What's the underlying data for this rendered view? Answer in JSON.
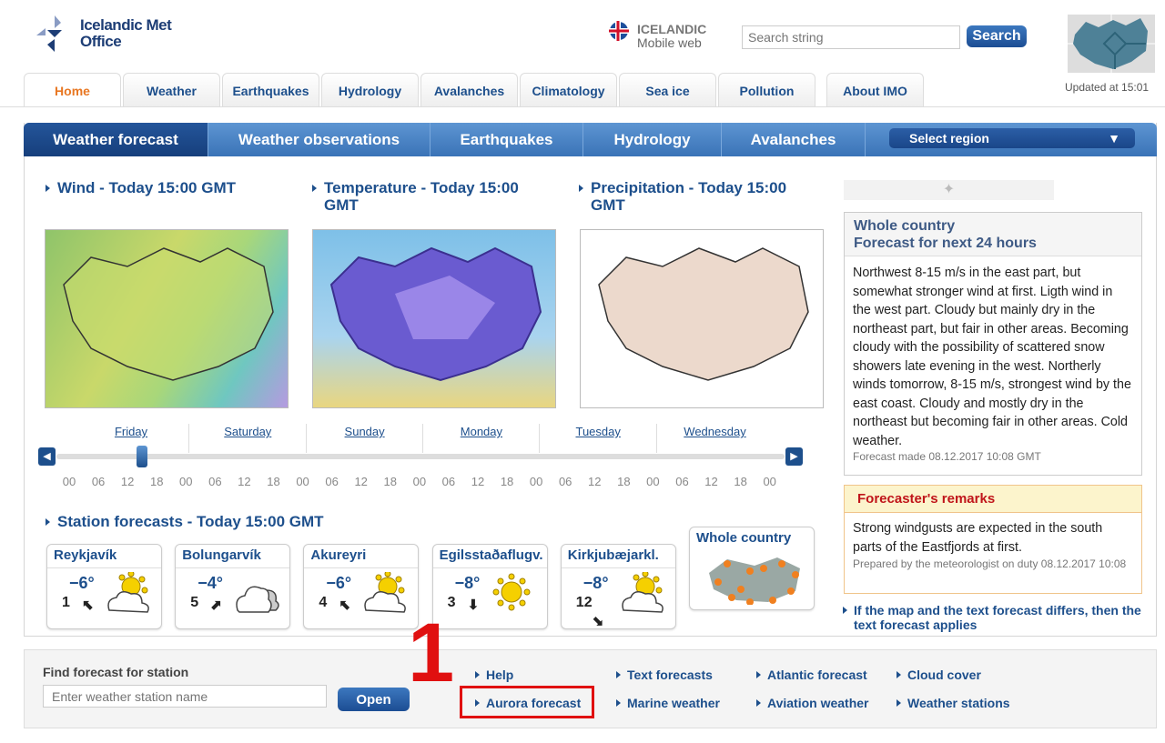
{
  "header": {
    "logo_text_1": "Icelandic Met",
    "logo_text_2": "Office",
    "lang_title": "ICELANDIC",
    "lang_sub": "Mobile web",
    "search_placeholder": "Search string",
    "search_button": "Search",
    "updated": "Updated at 15:01"
  },
  "tabs": [
    "Home",
    "Weather",
    "Earthquakes",
    "Hydrology",
    "Avalanches",
    "Climatology",
    "Sea ice",
    "Pollution",
    "About IMO"
  ],
  "active_tab": "Home",
  "subnav": {
    "items": [
      "Weather forecast",
      "Weather observations",
      "Earthquakes",
      "Hydrology",
      "Avalanches"
    ],
    "active": "Weather forecast",
    "region_select": "Select region"
  },
  "maps": [
    {
      "title": "Wind - Today 15:00 GMT"
    },
    {
      "title": "Temperature - Today 15:00 GMT"
    },
    {
      "title": "Precipitation - Today 15:00 GMT"
    }
  ],
  "timeline": {
    "days": [
      "Friday",
      "Saturday",
      "Sunday",
      "Monday",
      "Tuesday",
      "Wednesday"
    ],
    "hours": [
      "00",
      "06",
      "12",
      "18",
      "00",
      "06",
      "12",
      "18",
      "00",
      "06",
      "12",
      "18",
      "00",
      "06",
      "12",
      "18",
      "00",
      "06",
      "12",
      "18",
      "00",
      "06",
      "12",
      "18",
      "00"
    ],
    "selected": "Friday 15:00"
  },
  "stations": {
    "title": "Station forecasts - Today 15:00 GMT",
    "items": [
      {
        "name": "Reykjavík",
        "temp": "−6°",
        "wind": "1",
        "dir": "⬉",
        "icon": "partly-cloudy-icon"
      },
      {
        "name": "Bolungarvík",
        "temp": "−4°",
        "wind": "5",
        "dir": "⬈",
        "icon": "cloudy-icon"
      },
      {
        "name": "Akureyri",
        "temp": "−6°",
        "wind": "4",
        "dir": "⬉",
        "icon": "partly-cloudy-icon"
      },
      {
        "name": "Egilsstaðaflugv.",
        "temp": "−8°",
        "wind": "3",
        "dir": "⬇",
        "icon": "sun-icon"
      },
      {
        "name": "Kirkjubæjarkl.",
        "temp": "−8°",
        "wind": "12",
        "dir": "⬊",
        "icon": "partly-cloudy-icon"
      }
    ],
    "whole_country": "Whole country"
  },
  "forecast": {
    "title1": "Whole country",
    "title2": "Forecast for next 24 hours",
    "text": "Northwest 8-15 m/s in the east part, but somewhat stronger wind at first. Ligth wind in the west part. Cloudy but mainly dry in the northeast part, but fair in other areas. Becoming cloudy with the possibility of scattered snow showers late evening in the west. Northerly winds tomorrow, 8-15 m/s, strongest wind by the east coast. Cloudy and mostly dry in the northeast but becoming fair in other areas. Cold weather.",
    "made": "Forecast made 08.12.2017 10:08 GMT"
  },
  "remarks": {
    "title": "Forecaster's remarks",
    "text": "Strong windgusts are expected in the south parts of the Eastfjords at first.",
    "prepared": "Prepared by the meteorologist on duty 08.12.2017 10:08"
  },
  "note": "If the map and the text forecast differs, then the text forecast applies",
  "footer": {
    "find_label": "Find forecast for station",
    "find_placeholder": "Enter weather station name",
    "open_button": "Open",
    "links": [
      "Help",
      "Text forecasts",
      "Atlantic forecast",
      "Cloud cover",
      "Aurora forecast",
      "Marine weather",
      "Aviation weather",
      "Weather stations"
    ]
  },
  "annotation": {
    "number": "1",
    "highlighted": "Aurora forecast",
    "color": "#e01010"
  }
}
